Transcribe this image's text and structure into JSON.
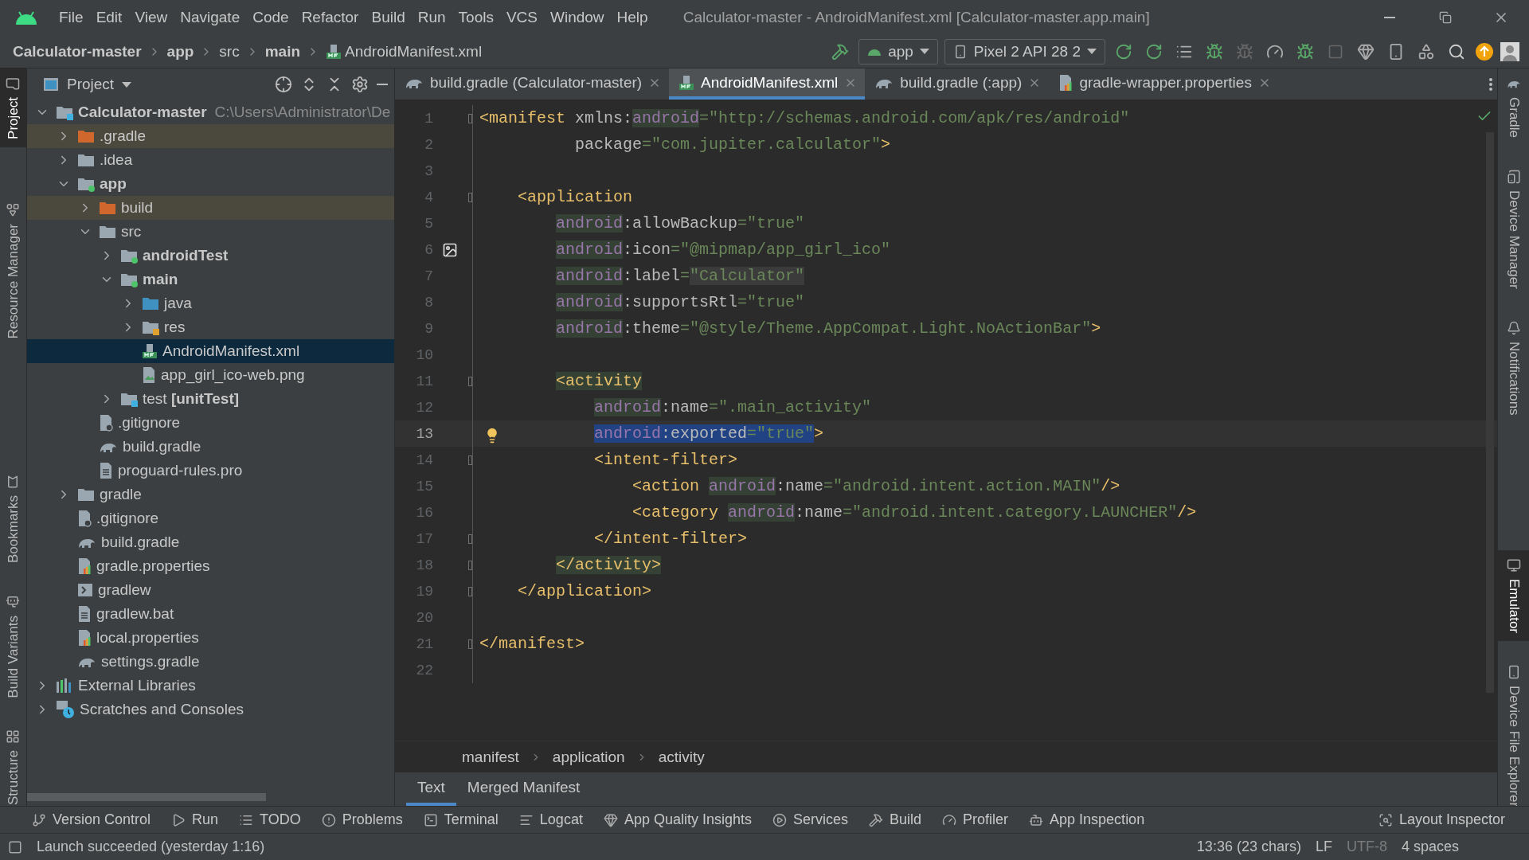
{
  "window": {
    "title": "Calculator-master - AndroidManifest.xml [Calculator-master.app.main]"
  },
  "menu": [
    "File",
    "Edit",
    "View",
    "Navigate",
    "Code",
    "Refactor",
    "Build",
    "Run",
    "Tools",
    "VCS",
    "Window",
    "Help"
  ],
  "breadcrumbs": [
    {
      "label": "Calculator-master",
      "bold": true
    },
    {
      "label": "app",
      "bold": true
    },
    {
      "label": "src",
      "bold": false
    },
    {
      "label": "main",
      "bold": true
    },
    {
      "label": "AndroidManifest.xml",
      "bold": false,
      "kind": "manifest"
    }
  ],
  "run_config": {
    "module": "app",
    "device": "Pixel 2 API 28 2"
  },
  "left_stripe": [
    {
      "label": "Project",
      "selected": true
    },
    {
      "label": "Resource Manager",
      "selected": false
    },
    {
      "label": "Bookmarks",
      "selected": false
    },
    {
      "label": "Build Variants",
      "selected": false
    },
    {
      "label": "Structure",
      "selected": false
    }
  ],
  "right_stripe": [
    {
      "label": "Gradle",
      "selected": false
    },
    {
      "label": "Device Manager",
      "selected": false
    },
    {
      "label": "Notifications",
      "selected": false
    },
    {
      "label": "Emulator",
      "selected": true
    },
    {
      "label": "Device File Explorer",
      "selected": false
    }
  ],
  "project": {
    "title": "Project",
    "tree": [
      {
        "label": "Calculator-master",
        "path": "C:\\Users\\Administrator\\De",
        "kind": "module",
        "bold": true,
        "selected": false,
        "excluded": false,
        "expanded": true,
        "children": [
          {
            "label": ".gradle",
            "kind": "excluded-folder",
            "bold": false,
            "selected": false,
            "excluded": true,
            "expanded": false
          },
          {
            "label": ".idea",
            "kind": "folder",
            "bold": false,
            "selected": false,
            "excluded": false,
            "expanded": false
          },
          {
            "label": "app",
            "kind": "source-module",
            "bold": true,
            "selected": false,
            "excluded": false,
            "expanded": true,
            "children": [
              {
                "label": "build",
                "kind": "excluded-folder",
                "bold": false,
                "selected": false,
                "excluded": true,
                "expanded": false
              },
              {
                "label": "src",
                "kind": "folder",
                "bold": false,
                "selected": false,
                "excluded": false,
                "expanded": true,
                "children": [
                  {
                    "label": "androidTest",
                    "kind": "source-module",
                    "bold": true,
                    "selected": false,
                    "excluded": false,
                    "expanded": false
                  },
                  {
                    "label": "main",
                    "kind": "source-module",
                    "bold": true,
                    "selected": false,
                    "excluded": false,
                    "expanded": true,
                    "children": [
                      {
                        "label": "java",
                        "kind": "source-folder",
                        "bold": false,
                        "selected": false,
                        "excluded": false,
                        "expanded": false
                      },
                      {
                        "label": "res",
                        "kind": "resource-folder",
                        "bold": false,
                        "selected": false,
                        "excluded": false,
                        "expanded": false
                      },
                      {
                        "label": "AndroidManifest.xml",
                        "kind": "manifest",
                        "bold": false,
                        "selected": true,
                        "excluded": false
                      },
                      {
                        "label": "app_girl_ico-web.png",
                        "kind": "image",
                        "bold": false,
                        "selected": false,
                        "excluded": false
                      }
                    ]
                  },
                  {
                    "label": "test **[unitTest]**",
                    "kind": "test-module",
                    "bold": false,
                    "selected": false,
                    "excluded": false,
                    "expanded": false
                  }
                ]
              },
              {
                "label": ".gitignore",
                "kind": "ignore",
                "bold": false,
                "selected": false,
                "excluded": false
              },
              {
                "label": "build.gradle",
                "kind": "gradle",
                "bold": false,
                "selected": false,
                "excluded": false
              },
              {
                "label": "proguard-rules.pro",
                "kind": "text",
                "bold": false,
                "selected": false,
                "excluded": false
              }
            ]
          },
          {
            "label": "gradle",
            "kind": "folder",
            "bold": false,
            "selected": false,
            "excluded": false,
            "expanded": false
          },
          {
            "label": ".gitignore",
            "kind": "ignore",
            "bold": false,
            "selected": false,
            "excluded": false
          },
          {
            "label": "build.gradle",
            "kind": "gradle",
            "bold": false,
            "selected": false,
            "excluded": false
          },
          {
            "label": "gradle.properties",
            "kind": "properties",
            "bold": false,
            "selected": false,
            "excluded": false
          },
          {
            "label": "gradlew",
            "kind": "script",
            "bold": false,
            "selected": false,
            "excluded": false
          },
          {
            "label": "gradlew.bat",
            "kind": "text",
            "bold": false,
            "selected": false,
            "excluded": false
          },
          {
            "label": "local.properties",
            "kind": "properties",
            "bold": false,
            "selected": false,
            "excluded": false
          },
          {
            "label": "settings.gradle",
            "kind": "gradle",
            "bold": false,
            "selected": false,
            "excluded": false
          }
        ]
      },
      {
        "label": "External Libraries",
        "kind": "libraries",
        "bold": false,
        "selected": false,
        "excluded": false,
        "expanded": false
      },
      {
        "label": "Scratches and Consoles",
        "kind": "scratches",
        "bold": false,
        "selected": false,
        "excluded": false,
        "expanded": false
      }
    ]
  },
  "editor_tabs": [
    {
      "label": "build.gradle (Calculator-master)",
      "kind": "gradle",
      "selected": false
    },
    {
      "label": "AndroidManifest.xml",
      "kind": "manifest",
      "selected": true
    },
    {
      "label": "build.gradle (:app)",
      "kind": "gradle",
      "selected": false
    },
    {
      "label": "gradle-wrapper.properties",
      "kind": "properties",
      "selected": false
    }
  ],
  "code": [
    {
      "number": "1",
      "kind": "plain",
      "fold": true,
      "current": false,
      "tokens": [
        {
          "kind": "tag",
          "text": "<manifest"
        },
        {
          "kind": "attr",
          "text": " xmlns:"
        },
        {
          "kind": "ns",
          "text": "android"
        },
        {
          "kind": "val",
          "text": "=\"http://schemas.android.com/apk/res/android\""
        }
      ]
    },
    {
      "number": "2",
      "kind": "plain",
      "fold": false,
      "current": false,
      "tokens": [
        {
          "kind": "attr",
          "text": "          package"
        },
        {
          "kind": "val",
          "text": "=\"com.jupiter.calculator\""
        },
        {
          "kind": "tag",
          "text": ">"
        }
      ]
    },
    {
      "number": "3",
      "kind": "plain",
      "fold": false,
      "current": false
    },
    {
      "number": "4",
      "kind": "plain",
      "fold": true,
      "current": false,
      "tokens": [
        {
          "kind": "tag",
          "text": "    <application"
        }
      ]
    },
    {
      "number": "5",
      "kind": "plain",
      "fold": false,
      "current": false,
      "tokens": [
        {
          "kind": "ns",
          "text": "        android"
        },
        {
          "kind": "attr",
          "text": ":allowBackup"
        },
        {
          "kind": "val",
          "text": "=\"true\""
        }
      ]
    },
    {
      "number": "6",
      "kind": "image",
      "fold": false,
      "current": false,
      "tokens": [
        {
          "kind": "ns",
          "text": "        android"
        },
        {
          "kind": "attr",
          "text": ":icon"
        },
        {
          "kind": "val",
          "text": "=\"@mipmap/app_girl_ico\""
        }
      ]
    },
    {
      "number": "7",
      "kind": "plain",
      "fold": false,
      "current": false,
      "tokens": [
        {
          "kind": "ns",
          "text": "        android"
        },
        {
          "kind": "attr",
          "text": ":label"
        },
        {
          "kind": "val",
          "text": "="
        },
        {
          "kind": "valhl",
          "text": "\"Calculator\""
        }
      ]
    },
    {
      "number": "8",
      "kind": "plain",
      "fold": false,
      "current": false,
      "tokens": [
        {
          "kind": "ns",
          "text": "        android"
        },
        {
          "kind": "attr",
          "text": ":supportsRtl"
        },
        {
          "kind": "val",
          "text": "=\"true\""
        }
      ]
    },
    {
      "number": "9",
      "kind": "plain",
      "fold": false,
      "current": false,
      "tokens": [
        {
          "kind": "ns",
          "text": "        android"
        },
        {
          "kind": "attr",
          "text": ":theme"
        },
        {
          "kind": "val",
          "text": "=\"@style/Theme.AppCompat.Light.NoActionBar\""
        },
        {
          "kind": "tag",
          "text": ">"
        }
      ]
    },
    {
      "number": "10",
      "kind": "plain",
      "fold": false,
      "current": false
    },
    {
      "number": "11",
      "kind": "plain",
      "fold": true,
      "current": false,
      "tokens": [
        {
          "kind": "taghl",
          "text": "        <activity"
        }
      ]
    },
    {
      "number": "12",
      "kind": "plain",
      "fold": false,
      "current": false,
      "tokens": [
        {
          "kind": "ns",
          "text": "            android"
        },
        {
          "kind": "attr",
          "text": ":name"
        },
        {
          "kind": "val",
          "text": "=\".main_activity\""
        }
      ]
    },
    {
      "number": "13",
      "kind": "bulb",
      "fold": false,
      "current": true,
      "tokens": [
        {
          "kind": "ns",
          "text": "            android",
          "selected": true
        },
        {
          "kind": "attr",
          "text": ":exported",
          "selected": true
        },
        {
          "kind": "val",
          "text": "=\"true\"",
          "selected": true
        },
        {
          "kind": "tag",
          "text": ">",
          "selected": false
        }
      ]
    },
    {
      "number": "14",
      "kind": "plain",
      "fold": true,
      "current": false,
      "tokens": [
        {
          "kind": "tag",
          "text": "            <intent-filter>"
        }
      ]
    },
    {
      "number": "15",
      "kind": "plain",
      "fold": false,
      "current": false,
      "tokens": [
        {
          "kind": "tag",
          "text": "                <action "
        },
        {
          "kind": "ns",
          "text": "android"
        },
        {
          "kind": "attr",
          "text": ":name"
        },
        {
          "kind": "val",
          "text": "=\"android.intent.action.MAIN\""
        },
        {
          "kind": "tag",
          "text": "/>"
        }
      ]
    },
    {
      "number": "16",
      "kind": "plain",
      "fold": false,
      "current": false,
      "tokens": [
        {
          "kind": "tag",
          "text": "                <category "
        },
        {
          "kind": "ns",
          "text": "android"
        },
        {
          "kind": "attr",
          "text": ":name"
        },
        {
          "kind": "val",
          "text": "=\"android.intent.category.LAUNCHER\""
        },
        {
          "kind": "tag",
          "text": "/>"
        }
      ]
    },
    {
      "number": "17",
      "kind": "plain",
      "fold": true,
      "current": false,
      "tokens": [
        {
          "kind": "tag",
          "text": "            </intent-filter>"
        }
      ]
    },
    {
      "number": "18",
      "kind": "plain",
      "fold": true,
      "current": false,
      "tokens": [
        {
          "kind": "taghl",
          "text": "        </activity>"
        }
      ]
    },
    {
      "number": "19",
      "kind": "plain",
      "fold": true,
      "current": false,
      "tokens": [
        {
          "kind": "tag",
          "text": "    </application>"
        }
      ]
    },
    {
      "number": "20",
      "kind": "plain",
      "fold": false,
      "current": false
    },
    {
      "number": "21",
      "kind": "plain",
      "fold": true,
      "current": false,
      "tokens": [
        {
          "kind": "tag",
          "text": "</manifest>"
        }
      ]
    },
    {
      "number": "22",
      "kind": "plain",
      "fold": false,
      "current": false
    }
  ],
  "editor_breadcrumbs": [
    "manifest",
    "application",
    "activity"
  ],
  "editor_bottom_tabs": [
    {
      "label": "Text",
      "selected": true
    },
    {
      "label": "Merged Manifest",
      "selected": false
    }
  ],
  "tool_windows": [
    "Version Control",
    "Run",
    "TODO",
    "Problems",
    "Terminal",
    "Logcat",
    "App Quality Insights",
    "Services",
    "Build",
    "Profiler",
    "App Inspection"
  ],
  "tool_windows_right": [
    "Layout Inspector"
  ],
  "status_bar": {
    "message": "Launch succeeded (yesterday 1:16)",
    "position": "13:36 (23 chars)",
    "line_separator": "LF",
    "encoding": "UTF-8",
    "indent": "4 spaces"
  }
}
